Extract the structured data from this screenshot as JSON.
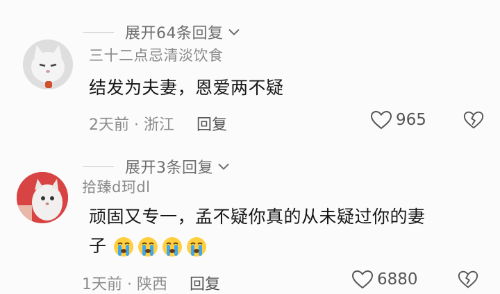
{
  "comments": [
    {
      "expand_label": "展开64条回复",
      "username": "三十二点忌清淡饮食",
      "text": "结发为夫妻，恩爱两不疑",
      "meta": "2天前 · 浙江",
      "reply_label": "回复",
      "likes": "965"
    },
    {
      "expand_label": "展开3条回复",
      "username": "拾臻d珂dl",
      "text_line1": "顽固又专一，孟不疑你真的从未疑过你的妻",
      "text_line2": "子",
      "emoji_count": 4,
      "meta": "1天前 · 陕西",
      "reply_label": "回复",
      "likes": "6880"
    }
  ],
  "colors": {
    "background": "#fbfbfb",
    "muted": "#8c8c8c",
    "text": "#161616"
  }
}
